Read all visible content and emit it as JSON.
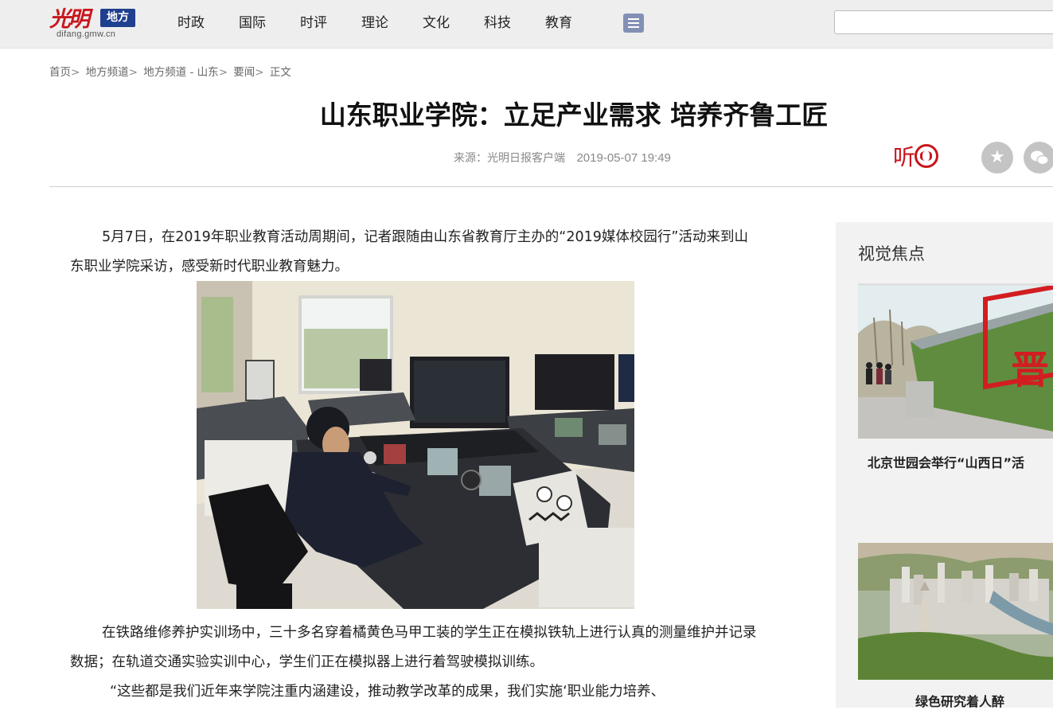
{
  "site": {
    "logo_calligraphy": "光明",
    "logo_badge": "地方",
    "logo_domain": "difang.gmw.cn"
  },
  "nav": {
    "items": [
      "时政",
      "国际",
      "时评",
      "理论",
      "文化",
      "科技",
      "教育"
    ],
    "menu_icon": "list-menu-icon"
  },
  "search": {
    "value": "",
    "placeholder": ""
  },
  "breadcrumb": {
    "items": [
      "首页",
      "地方频道",
      "地方频道 - 山东",
      "要闻",
      "正文"
    ],
    "separator": ">"
  },
  "article": {
    "title": "山东职业学院：立足产业需求 培养齐鲁工匠",
    "source": "来源：光明日报客户端",
    "date": "2019-05-07 19:49",
    "paragraphs": [
      "5月7日，在2019年职业教育活动周期间，记者跟随由山东省教育厅主办的“2019媒体校园行”活动来到山东职业学院采访，感受新时代职业教育魅力。",
      "在铁路维修养护实训场中，三十多名穿着橘黄色马甲工装的学生正在模拟铁轨上进行认真的测量维护并记录数据；在轨道交通实验实训中心，学生们正在模拟器上进行着驾驶模拟训练。",
      "“这些都是我们近年来学院注重内涵建设，推动教学改革的成果，我们实施‘职业能力培养、"
    ]
  },
  "actions": {
    "listen_label": "听",
    "favorite_icon": "star-icon",
    "share_icon": "wechat-icon"
  },
  "sidebar": {
    "title": "视觉焦点",
    "items": [
      {
        "caption": "北京世园会举行“山西日”活"
      },
      {
        "caption": "绿色研究着人醉"
      }
    ]
  },
  "colors": {
    "brand_red": "#c8161d",
    "brand_blue": "#1f3f8f",
    "nav_bg": "#eeeeee"
  }
}
